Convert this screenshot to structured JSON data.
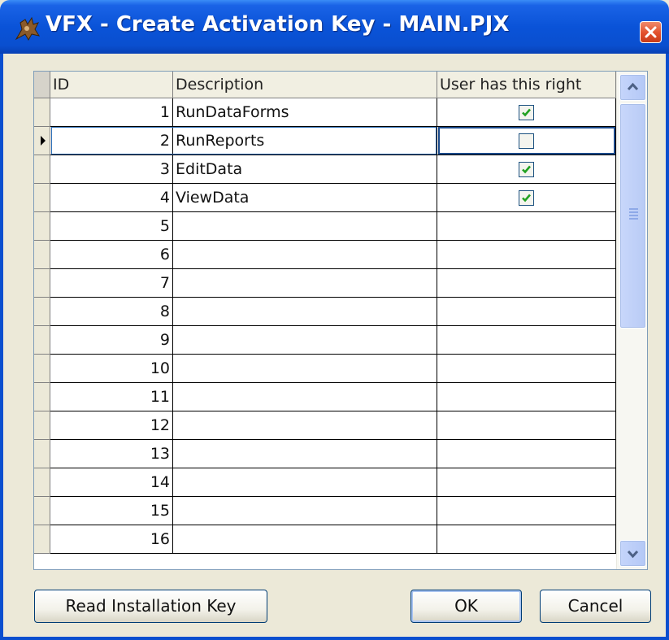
{
  "window": {
    "title": "VFX - Create Activation Key - MAIN.PJX"
  },
  "grid": {
    "columns": [
      "ID",
      "Description",
      "User has this right"
    ],
    "current_row": 2,
    "rows": [
      {
        "id": "1",
        "description": "RunDataForms",
        "has_right": true
      },
      {
        "id": "2",
        "description": "RunReports",
        "has_right": false
      },
      {
        "id": "3",
        "description": "EditData",
        "has_right": true
      },
      {
        "id": "4",
        "description": "ViewData",
        "has_right": true
      },
      {
        "id": "5",
        "description": "",
        "has_right": null
      },
      {
        "id": "6",
        "description": "",
        "has_right": null
      },
      {
        "id": "7",
        "description": "",
        "has_right": null
      },
      {
        "id": "8",
        "description": "",
        "has_right": null
      },
      {
        "id": "9",
        "description": "",
        "has_right": null
      },
      {
        "id": "10",
        "description": "",
        "has_right": null
      },
      {
        "id": "11",
        "description": "",
        "has_right": null
      },
      {
        "id": "12",
        "description": "",
        "has_right": null
      },
      {
        "id": "13",
        "description": "",
        "has_right": null
      },
      {
        "id": "14",
        "description": "",
        "has_right": null
      },
      {
        "id": "15",
        "description": "",
        "has_right": null
      },
      {
        "id": "16",
        "description": "",
        "has_right": null
      }
    ]
  },
  "buttons": {
    "read_installation_key": "Read Installation Key",
    "ok": "OK",
    "cancel": "Cancel"
  },
  "colors": {
    "titlebar": "#0a4fcf",
    "dialog_bg": "#ece9d8",
    "check_green": "#21a121"
  },
  "icons": {
    "app": "vfx-app-icon",
    "close": "close-icon",
    "scroll_up": "arrow-up-icon",
    "scroll_down": "arrow-down-icon",
    "row_pointer": "row-pointer-icon",
    "checkmark": "checkmark-icon"
  }
}
